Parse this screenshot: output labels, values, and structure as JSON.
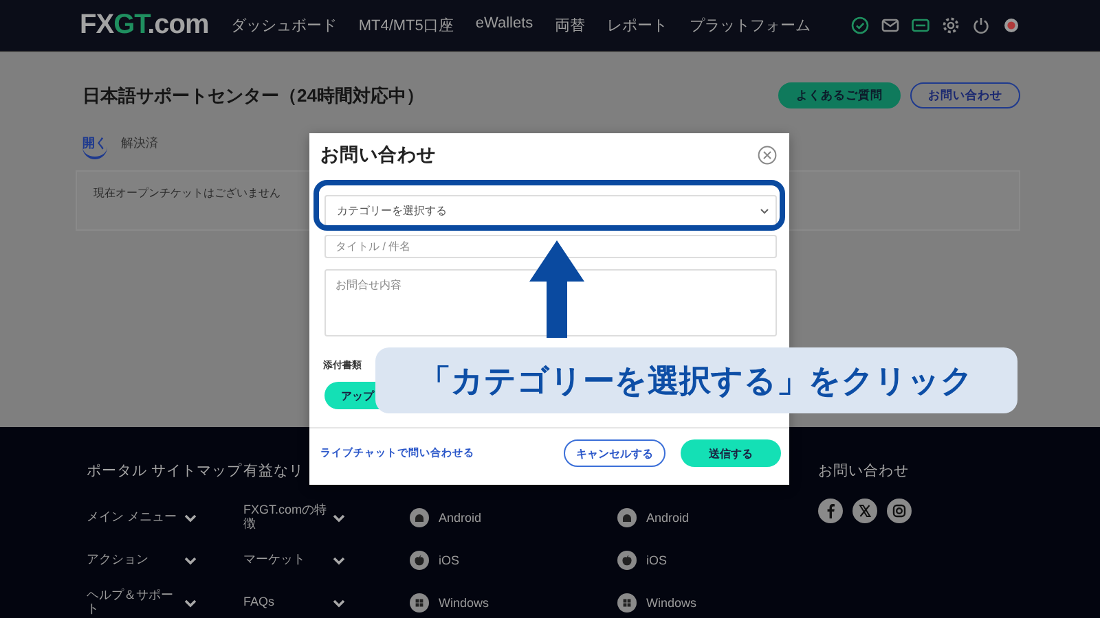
{
  "header": {
    "logo": [
      {
        "text": "FX",
        "kind": "plain"
      },
      {
        "text": "GT",
        "kind": "accent"
      },
      {
        "text": ".com",
        "kind": "plain"
      }
    ],
    "nav": [
      "ダッシュボード",
      "MT4/MT5口座",
      "eWallets",
      "両替",
      "レポート",
      "プラットフォーム"
    ]
  },
  "page": {
    "title": "日本語サポートセンター（24時間対応中）",
    "buttons": [
      {
        "label": "よくあるご質問",
        "kind": "filled"
      },
      {
        "label": "お問い合わせ",
        "kind": "outline"
      }
    ],
    "tabs": [
      {
        "label": "開く",
        "selected": true
      },
      {
        "label": "解決済",
        "selected": false
      }
    ],
    "empty_message": "現在オープンチケットはございません"
  },
  "modal": {
    "title": "お問い合わせ",
    "category_select": {
      "placeholder": "カテゴリーを選択する"
    },
    "subject_field": {
      "placeholder": "タイトル / 件名"
    },
    "message_field": {
      "placeholder": "お問合せ内容"
    },
    "attachment_label": "添付書類",
    "upload_button": "アップ",
    "live_chat_link": "ライブチャットで問い合わせる",
    "buttons": [
      {
        "label": "キャンセルする",
        "kind": "outline"
      },
      {
        "label": "送信する",
        "kind": "filled"
      }
    ]
  },
  "footer": {
    "columns": [
      {
        "kind": "links",
        "heading": "ポータル サイトマップ",
        "items": [
          {
            "label": "メイン メニュー",
            "kind": "expandable"
          },
          {
            "label": "アクション",
            "kind": "expandable"
          },
          {
            "label": "ヘルプ＆サポート",
            "kind": "expandable"
          }
        ]
      },
      {
        "kind": "links",
        "heading": "有益なリ",
        "items": [
          {
            "label": "FXGT.comの特徴",
            "kind": "expandable"
          },
          {
            "label": "マーケット",
            "kind": "expandable"
          },
          {
            "label": "FAQs",
            "kind": "expandable"
          }
        ]
      },
      {
        "kind": "links",
        "items": [
          {
            "label": "Android",
            "kind": "android"
          },
          {
            "label": "iOS",
            "kind": "ios"
          },
          {
            "label": "Windows",
            "kind": "windows"
          }
        ]
      },
      {
        "kind": "links",
        "items": [
          {
            "label": "Android",
            "kind": "android"
          },
          {
            "label": "iOS",
            "kind": "ios"
          },
          {
            "label": "Windows",
            "kind": "windows"
          }
        ]
      },
      {
        "kind": "social",
        "heading": "お問い合わせ"
      }
    ]
  },
  "annotation": {
    "caption": "「カテゴリーを選択する」をクリック"
  }
}
